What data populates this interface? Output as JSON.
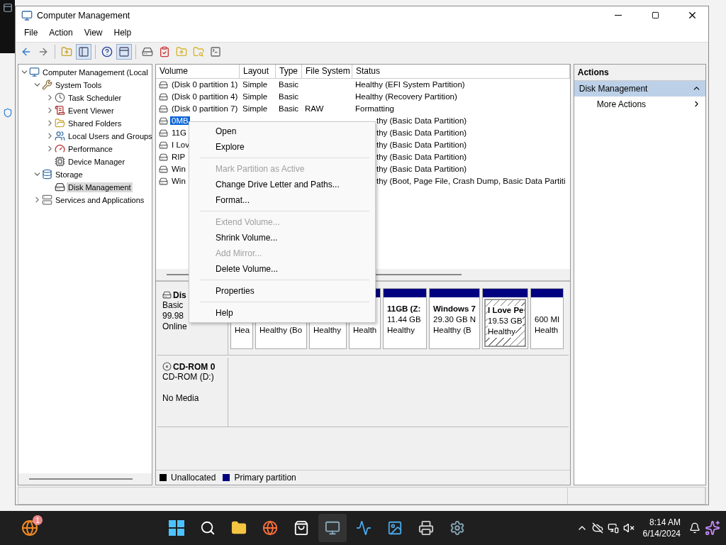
{
  "window": {
    "title": "Computer Management"
  },
  "menu_bar": [
    "File",
    "Action",
    "View",
    "Help"
  ],
  "tree": [
    {
      "label": "Computer Management (Local",
      "selected": false,
      "expanded": true,
      "children": [
        {
          "label": "System Tools",
          "selected": false,
          "expanded": true,
          "children": [
            {
              "label": "Task Scheduler",
              "selected": false,
              "expanded": false
            },
            {
              "label": "Event Viewer",
              "selected": false,
              "expanded": false
            },
            {
              "label": "Shared Folders",
              "selected": false,
              "expanded": false
            },
            {
              "label": "Local Users and Groups",
              "selected": false,
              "expanded": false
            },
            {
              "label": "Performance",
              "selected": false,
              "expanded": false
            },
            {
              "label": "Device Manager",
              "selected": false
            }
          ]
        },
        {
          "label": "Storage",
          "selected": false,
          "expanded": true,
          "children": [
            {
              "label": "Disk Management",
              "selected": true
            }
          ]
        },
        {
          "label": "Services and Applications",
          "selected": false,
          "expanded": false
        }
      ]
    }
  ],
  "volume_table": {
    "columns": [
      "Volume",
      "Layout",
      "Type",
      "File System",
      "Status"
    ],
    "rows": [
      {
        "volume": "(Disk 0 partition 1)",
        "layout": "Simple",
        "type": "Basic",
        "status": "Healthy (EFI System Partition)",
        "selected": false
      },
      {
        "volume": "(Disk 0 partition 4)",
        "layout": "Simple",
        "type": "Basic",
        "status": "Healthy (Recovery Partition)",
        "selected": false
      },
      {
        "volume": "(Disk 0 partition 7)",
        "layout": "Simple",
        "type": "Basic",
        "file_system": "RAW",
        "status": "Formatting",
        "selected": false
      },
      {
        "volume": "0MB",
        "status": "thy (Basic Data Partition)",
        "selected": true
      },
      {
        "volume": "11G",
        "status": "thy (Basic Data Partition)",
        "selected": false
      },
      {
        "volume": "I Lov",
        "status": "thy (Basic Data Partition)",
        "selected": false
      },
      {
        "volume": "RIP",
        "status": "thy (Basic Data Partition)",
        "selected": false
      },
      {
        "volume": "Win",
        "status": "thy (Basic Data Partition)",
        "selected": false
      },
      {
        "volume": "Win",
        "status": "thy (Boot, Page File, Crash Dump, Basic Data Partiti",
        "selected": false
      }
    ]
  },
  "disks": [
    {
      "kind": "disk",
      "name": "Dis",
      "lines": [
        "Basic",
        "99.98",
        "Online"
      ],
      "partitions": [
        {
          "status": "Hea",
          "selected": false
        },
        {
          "status": "Healthy (Bo",
          "selected": false
        },
        {
          "status": "Healthy",
          "selected": false
        },
        {
          "status": "Health",
          "selected": false
        },
        {
          "name": "11GB  (Z:",
          "size": "11.44 GB",
          "status": "Healthy",
          "selected": false
        },
        {
          "name": "Windows 7",
          "size": "29.30 GB N",
          "status": "Healthy (B",
          "selected": false
        },
        {
          "name": "I Love Pe",
          "size": "19.53 GB",
          "status": "Healthy",
          "selected": true
        },
        {
          "size": "600 MI",
          "status": "Health",
          "selected": false
        }
      ]
    },
    {
      "kind": "cdrom",
      "name": "CD-ROM 0",
      "lines": [
        "CD-ROM (D:)",
        "No Media"
      ]
    }
  ],
  "legend": [
    {
      "label": "Unallocated",
      "color": "#000000"
    },
    {
      "label": "Primary partition",
      "color": "#000080"
    }
  ],
  "context_menu": [
    {
      "kind": "item",
      "label": "Open",
      "disabled": false
    },
    {
      "kind": "item",
      "label": "Explore",
      "disabled": false
    },
    {
      "kind": "separator"
    },
    {
      "kind": "item",
      "label": "Mark Partition as Active",
      "disabled": true
    },
    {
      "kind": "item",
      "label": "Change Drive Letter and Paths...",
      "disabled": false
    },
    {
      "kind": "item",
      "label": "Format...",
      "disabled": false
    },
    {
      "kind": "separator"
    },
    {
      "kind": "item",
      "label": "Extend Volume...",
      "disabled": true
    },
    {
      "kind": "item",
      "label": "Shrink Volume...",
      "disabled": false
    },
    {
      "kind": "item",
      "label": "Add Mirror...",
      "disabled": true
    },
    {
      "kind": "item",
      "label": "Delete Volume...",
      "disabled": false
    },
    {
      "kind": "separator"
    },
    {
      "kind": "item",
      "label": "Properties",
      "disabled": false
    },
    {
      "kind": "separator"
    },
    {
      "kind": "item",
      "label": "Help",
      "disabled": false
    }
  ],
  "actions": {
    "title": "Actions",
    "sections": [
      {
        "label": "Disk Management",
        "expanded": true,
        "items": [
          "More Actions"
        ]
      }
    ]
  },
  "taskbar": {
    "badge": "1",
    "time": "8:14 AM",
    "date": "6/14/2024"
  }
}
